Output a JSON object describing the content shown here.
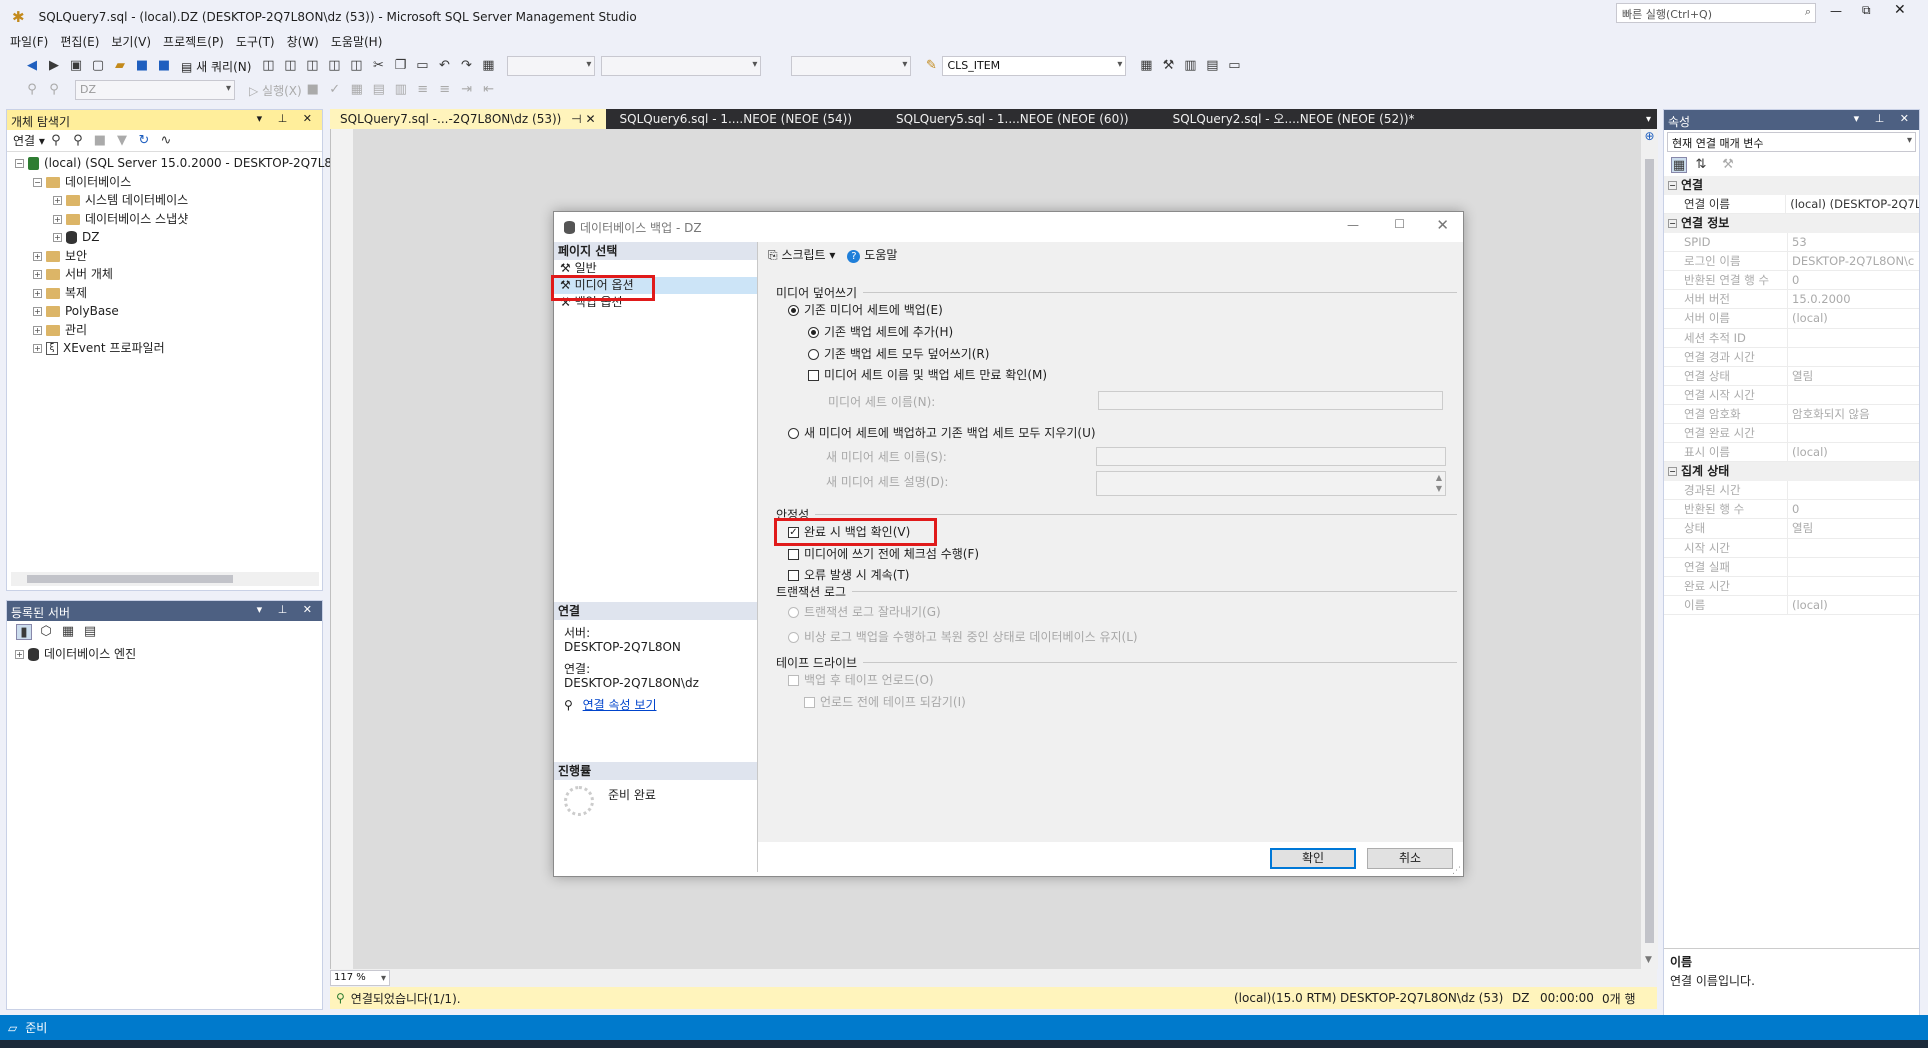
{
  "window": {
    "title": "SQLQuery7.sql - (local).DZ (DESKTOP-2Q7L8ON\\dz (53)) - Microsoft SQL Server Management Studio",
    "quick_launch_placeholder": "빠른 실행(Ctrl+Q)"
  },
  "menu": [
    "파일(F)",
    "편집(E)",
    "보기(V)",
    "프로젝트(P)",
    "도구(T)",
    "창(W)",
    "도움말(H)"
  ],
  "toolbar": {
    "new_query": "새 쿼리(N)",
    "object_combo": "CLS_ITEM",
    "db_combo": "DZ",
    "execute": "실행(X)"
  },
  "object_explorer": {
    "title": "개체 탐색기",
    "connect_label": "연결",
    "nodes": [
      "(local) (SQL Server 15.0.2000 - DESKTOP-2Q7L8C",
      "데이터베이스",
      "시스템 데이터베이스",
      "데이터베이스 스냅샷",
      "DZ",
      "보안",
      "서버 개체",
      "복제",
      "PolyBase",
      "관리",
      "XEvent 프로파일러"
    ]
  },
  "registered_servers": {
    "title": "등록된 서버",
    "nodes": [
      "데이터베이스 엔진"
    ]
  },
  "tabs": [
    "SQLQuery7.sql -...-2Q7L8ON\\dz (53))",
    "SQLQuery6.sql - 1....NEOE (NEOE (54))",
    "SQLQuery5.sql - 1....NEOE (NEOE (60))",
    "SQLQuery2.sql - 오....NEOE (NEOE (52))*"
  ],
  "dialog": {
    "title": "데이터베이스 백업 - DZ",
    "page_select": "페이지 선택",
    "pages": [
      "일반",
      "미디어 옵션",
      "백업 옵션"
    ],
    "script": "스크립트",
    "help": "도움말",
    "overwrite_group": "미디어 덮어쓰기",
    "existing_media": "기존 미디어 세트에 백업(E)",
    "append": "기존 백업 세트에 추가(H)",
    "overwrite_all": "기존 백업 세트 모두 덮어쓰기(R)",
    "check_media": "미디어 세트 이름 및 백업 세트 만료 확인(M)",
    "media_set_name": "미디어 세트 이름(N):",
    "new_media": "새 미디어 세트에 백업하고 기존 백업 세트 모두 지우기(U)",
    "new_media_name": "새 미디어 세트 이름(S):",
    "new_media_desc": "새 미디어 세트 설명(D):",
    "reliability_group": "안정성",
    "verify": "완료 시 백업 확인(V)",
    "checksum": "미디어에 쓰기 전에 체크섬 수행(F)",
    "continue_error": "오류 발생 시 계속(T)",
    "log_group": "트랜잭션 로그",
    "truncate_log": "트랜잭션 로그 잘라내기(G)",
    "tail_log": "비상 로그 백업을 수행하고 복원 중인 상태로 데이터베이스 유지(L)",
    "tape_group": "테이프 드라이브",
    "unload": "백업 후 테이프 언로드(O)",
    "rewind": "언로드 전에 테이프 되감기(I)",
    "connection_section": "연결",
    "server_label": "서버:",
    "server_value": "DESKTOP-2Q7L8ON",
    "conn_label": "연결:",
    "conn_value": "DESKTOP-2Q7L8ON\\dz",
    "conn_props_link": "연결 속성 보기",
    "progress_section": "진행률",
    "progress_status": "준비 완료",
    "ok": "확인",
    "cancel": "취소"
  },
  "properties": {
    "title": "속성",
    "selector": "현재 연결 매개 변수",
    "categories": [
      {
        "name": "연결",
        "rows": [
          [
            "연결 이름",
            "(local) (DESKTOP-2Q7L"
          ]
        ]
      },
      {
        "name": "연결 정보",
        "rows": [
          [
            "SPID",
            "53"
          ],
          [
            "로그인 이름",
            "DESKTOP-2Q7L8ON\\c"
          ],
          [
            "반환된 연결 행 수",
            "0"
          ],
          [
            "서버 버전",
            "15.0.2000"
          ],
          [
            "서버 이름",
            "(local)"
          ],
          [
            "세션 추적 ID",
            ""
          ],
          [
            "연결 경과 시간",
            ""
          ],
          [
            "연결 상태",
            "열림"
          ],
          [
            "연결 시작 시간",
            ""
          ],
          [
            "연결 암호화",
            "암호화되지 않음"
          ],
          [
            "연결 완료 시간",
            ""
          ],
          [
            "표시 이름",
            "(local)"
          ]
        ]
      },
      {
        "name": "집계 상태",
        "rows": [
          [
            "경과된 시간",
            ""
          ],
          [
            "반환된 행 수",
            "0"
          ],
          [
            "상태",
            "열림"
          ],
          [
            "시작 시간",
            ""
          ],
          [
            "연결 실패",
            ""
          ],
          [
            "완료 시간",
            ""
          ],
          [
            "이름",
            "(local)"
          ]
        ]
      }
    ],
    "desc_title": "이름",
    "desc_text": "연결 이름입니다."
  },
  "editor_status": {
    "zoom": "117 %",
    "connected": "연결되었습니다(1/1).",
    "server": "(local)(15.0 RTM)",
    "user": "DESKTOP-2Q7L8ON\\dz (53)",
    "db": "DZ",
    "time": "00:00:00",
    "rows": "0개 행"
  },
  "status": {
    "ready": "준비"
  }
}
